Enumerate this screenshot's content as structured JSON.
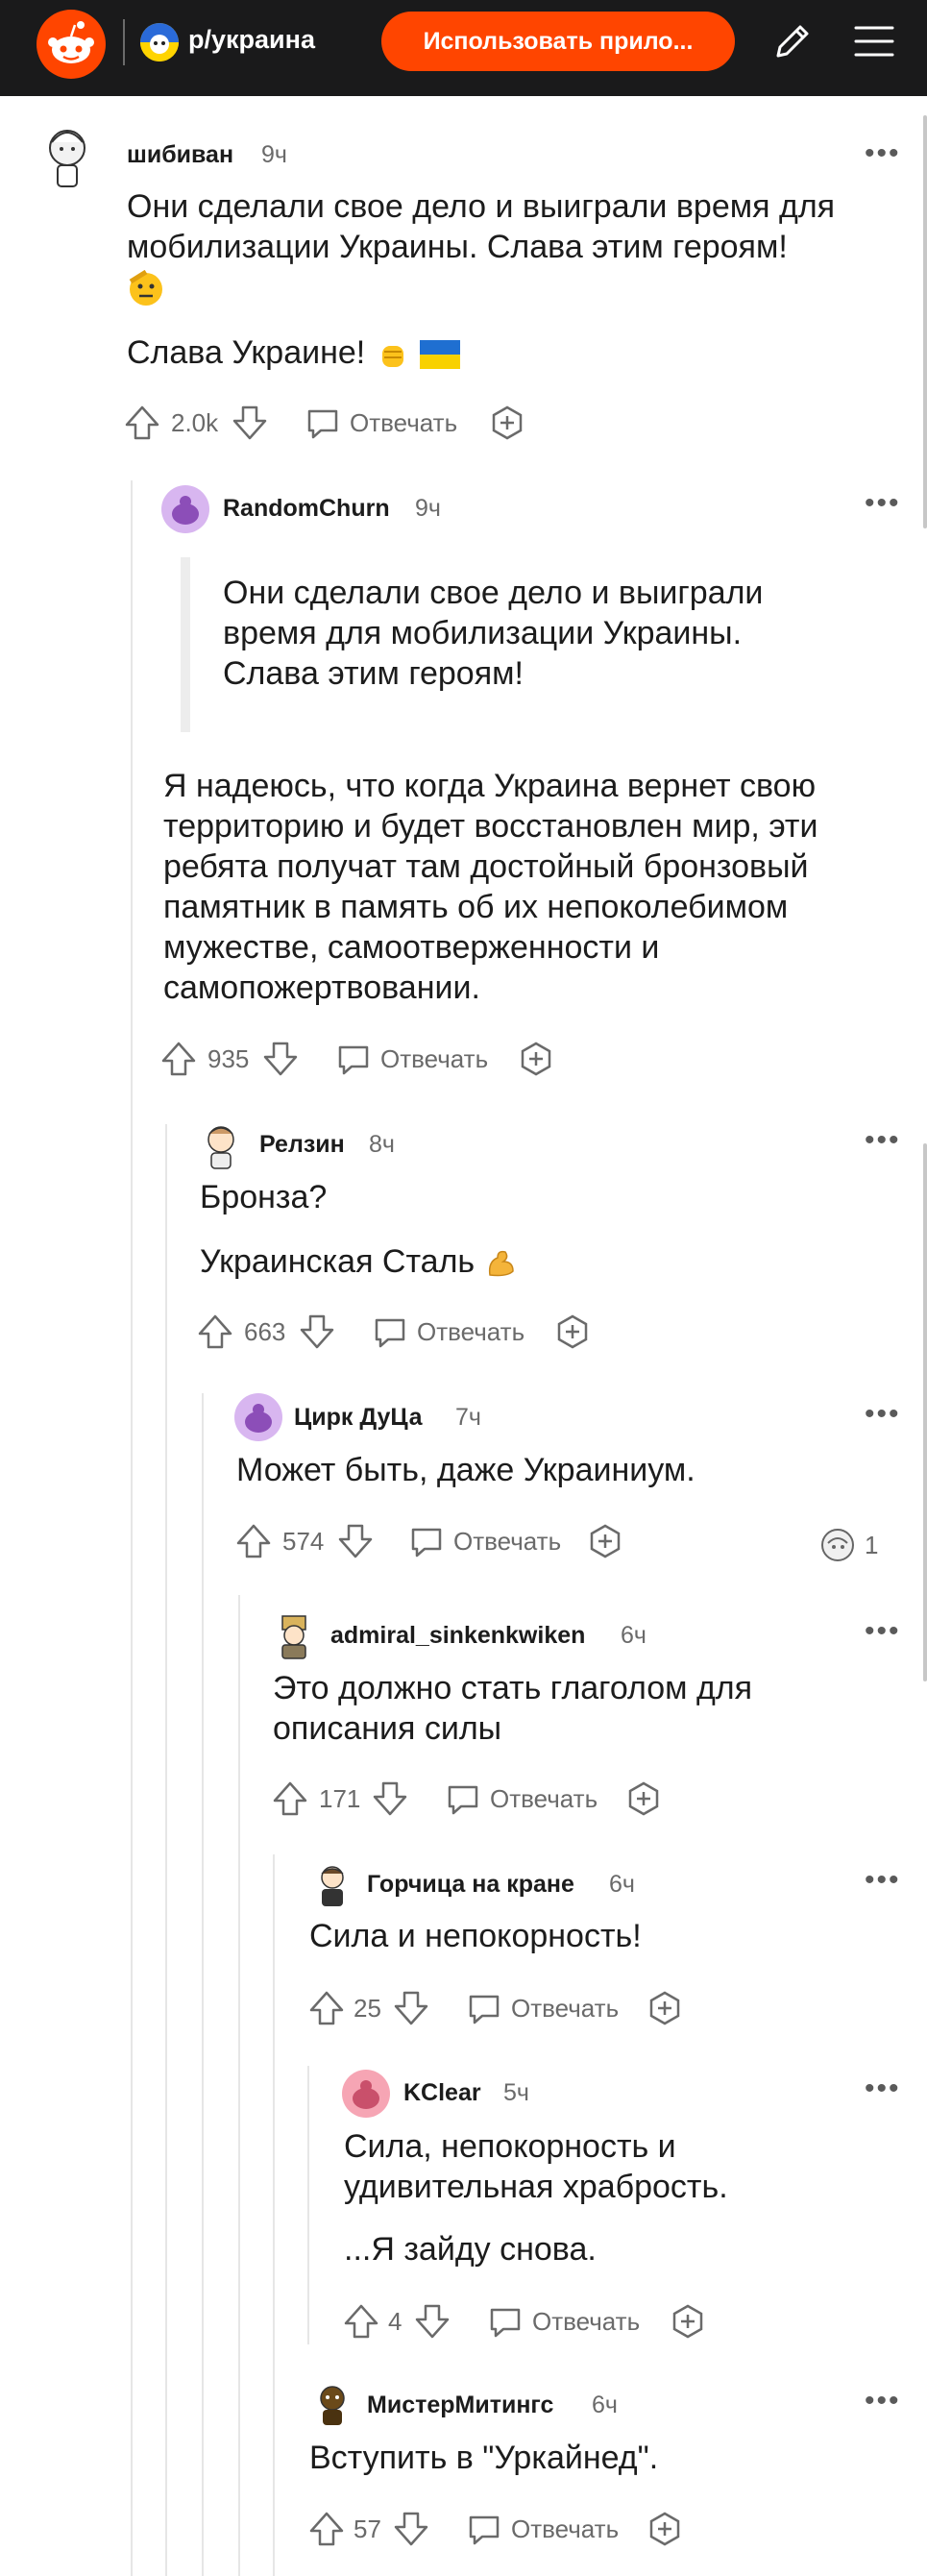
{
  "header": {
    "subreddit": "р/украина",
    "open_app_label": "Использовать прило...",
    "logo_icon": "reddit-logo-icon",
    "edit_icon": "pencil-icon",
    "menu_icon": "hamburger-menu-icon"
  },
  "reply_label": "Отвечать",
  "comments": [
    {
      "author": "шибиван",
      "time": "9ч",
      "lines": [
        "Они сделали свое дело и выиграли время для",
        "мобилизации Украины. Слава этим героям!"
      ],
      "extra": "Слава Украине!",
      "votes": "2.0k"
    },
    {
      "author": "RandomChurn",
      "time": "9ч",
      "quote": [
        "Они сделали свое дело и выиграли",
        "время для мобилизации Украины.",
        "Слава этим героям!"
      ],
      "lines": [
        "Я надеюсь, что когда Украина вернет свою",
        "территорию и будет восстановлен мир, эти",
        "ребята получат там достойный бронзовый",
        "памятник в память об их непоколебимом",
        "мужестве, самоотверженности и",
        "самопожертвовании."
      ],
      "votes": "935"
    },
    {
      "author": "Релзин",
      "time": "8ч",
      "line1": "Бронза?",
      "line2": "Украинская Сталь",
      "votes": "663"
    },
    {
      "author": "Цирк ДуЦа",
      "time": "7ч",
      "line1": "Может быть, даже Украиниум.",
      "votes": "574",
      "award_count": "1"
    },
    {
      "author": "admiral_sinkenkwiken",
      "time": "6ч",
      "lines": [
        "Это должно стать глаголом для",
        "описания силы"
      ],
      "votes": "171"
    },
    {
      "author": "Горчица на кране",
      "time": "6ч",
      "line1": "Сила и непокорность!",
      "votes": "25"
    },
    {
      "author": "KClear",
      "time": "5ч",
      "lines": [
        "Сила, непокорность и",
        "удивительная храбрость."
      ],
      "extra": "...Я зайду снова.",
      "votes": "4"
    },
    {
      "author": "МистерМитингс",
      "time": "6ч",
      "line1": "Вступить в \"Уркайнед\".",
      "votes": "57"
    }
  ],
  "colors": {
    "header_bg": "#1a1a1b",
    "accent": "#ff4500",
    "text": "#1c1c1c",
    "meta": "#6a6a6a"
  }
}
